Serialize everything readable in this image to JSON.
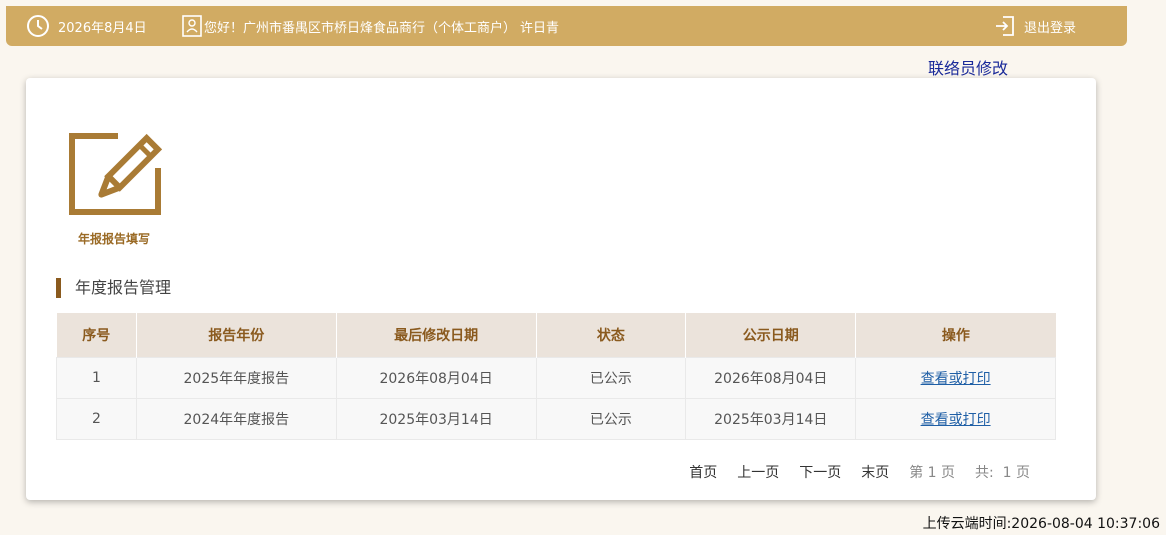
{
  "header": {
    "date": "2026年8月4日",
    "greeting": "您好！广州市番禺区市桥日烽食品商行（个体工商户）",
    "contact_name": "许日青",
    "logout_label": "退出登录"
  },
  "contact_edit_label": "联络员修改",
  "tile": {
    "label": "年报报告填写",
    "icon": "edit-icon"
  },
  "section_title": "年度报告管理",
  "table": {
    "headers": [
      "序号",
      "报告年份",
      "最后修改日期",
      "状态",
      "公示日期",
      "操作"
    ],
    "rows": [
      [
        "1",
        "2025年年度报告",
        "2026年08月04日",
        "已公示",
        "2026年08月04日",
        "查看或打印"
      ],
      [
        "2",
        "2024年年度报告",
        "2025年03月14日",
        "已公示",
        "2025年03月14日",
        "查看或打印"
      ]
    ]
  },
  "pager": {
    "first": "首页",
    "prev": "上一页",
    "next": "下一页",
    "last": "末页",
    "current": "第 1 页",
    "total": "共:  1 页"
  },
  "upload_time": "上传云端时间:2026-08-04 10:37:06",
  "colors": {
    "header_bg": "#d1ab63",
    "accent": "#8a5a1e",
    "link": "#1f5fa6",
    "table_header_bg": "#ebe3db"
  }
}
